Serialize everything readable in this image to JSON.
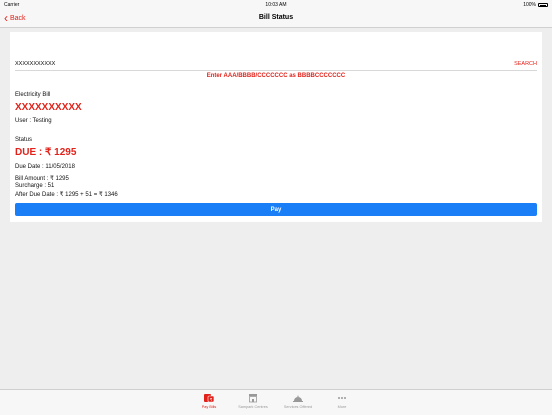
{
  "status_bar": {
    "carrier": "Carrier",
    "time": "10:03 AM",
    "battery": "100%"
  },
  "nav": {
    "back_label": "Back",
    "title": "Bill Status"
  },
  "search": {
    "value": "XXXXXXXXXXX",
    "button_label": "SEARCH"
  },
  "hint": "Enter AAA/BBBB/CCCCCCC as BBBBCCCCCCC",
  "bill": {
    "type_label": "Electricity Bill",
    "number": "XXXXXXXXXX",
    "user": "User : Testing",
    "status_label": "Status",
    "due": "DUE : ₹ 1295",
    "due_date": "Due Date : 11/05/2018",
    "bill_amount": "Bill Amount : ₹ 1295",
    "surcharge": "Surcharge : 51",
    "after_due": "After Due Date : ₹ 1295 + 51 = ₹ 1346"
  },
  "pay_label": "Pay",
  "tabs": [
    {
      "label": "Pay Bills",
      "icon": "pay-bills-icon",
      "active": true
    },
    {
      "label": "Sampark Centres",
      "icon": "store-icon",
      "active": false
    },
    {
      "label": "Services Offered",
      "icon": "service-bell-icon",
      "active": false
    },
    {
      "label": "More",
      "icon": "more-dots-icon",
      "active": false
    }
  ],
  "colors": {
    "accent": "#e2221a",
    "primary_button": "#1a7ef7",
    "background": "#eeeeee"
  }
}
